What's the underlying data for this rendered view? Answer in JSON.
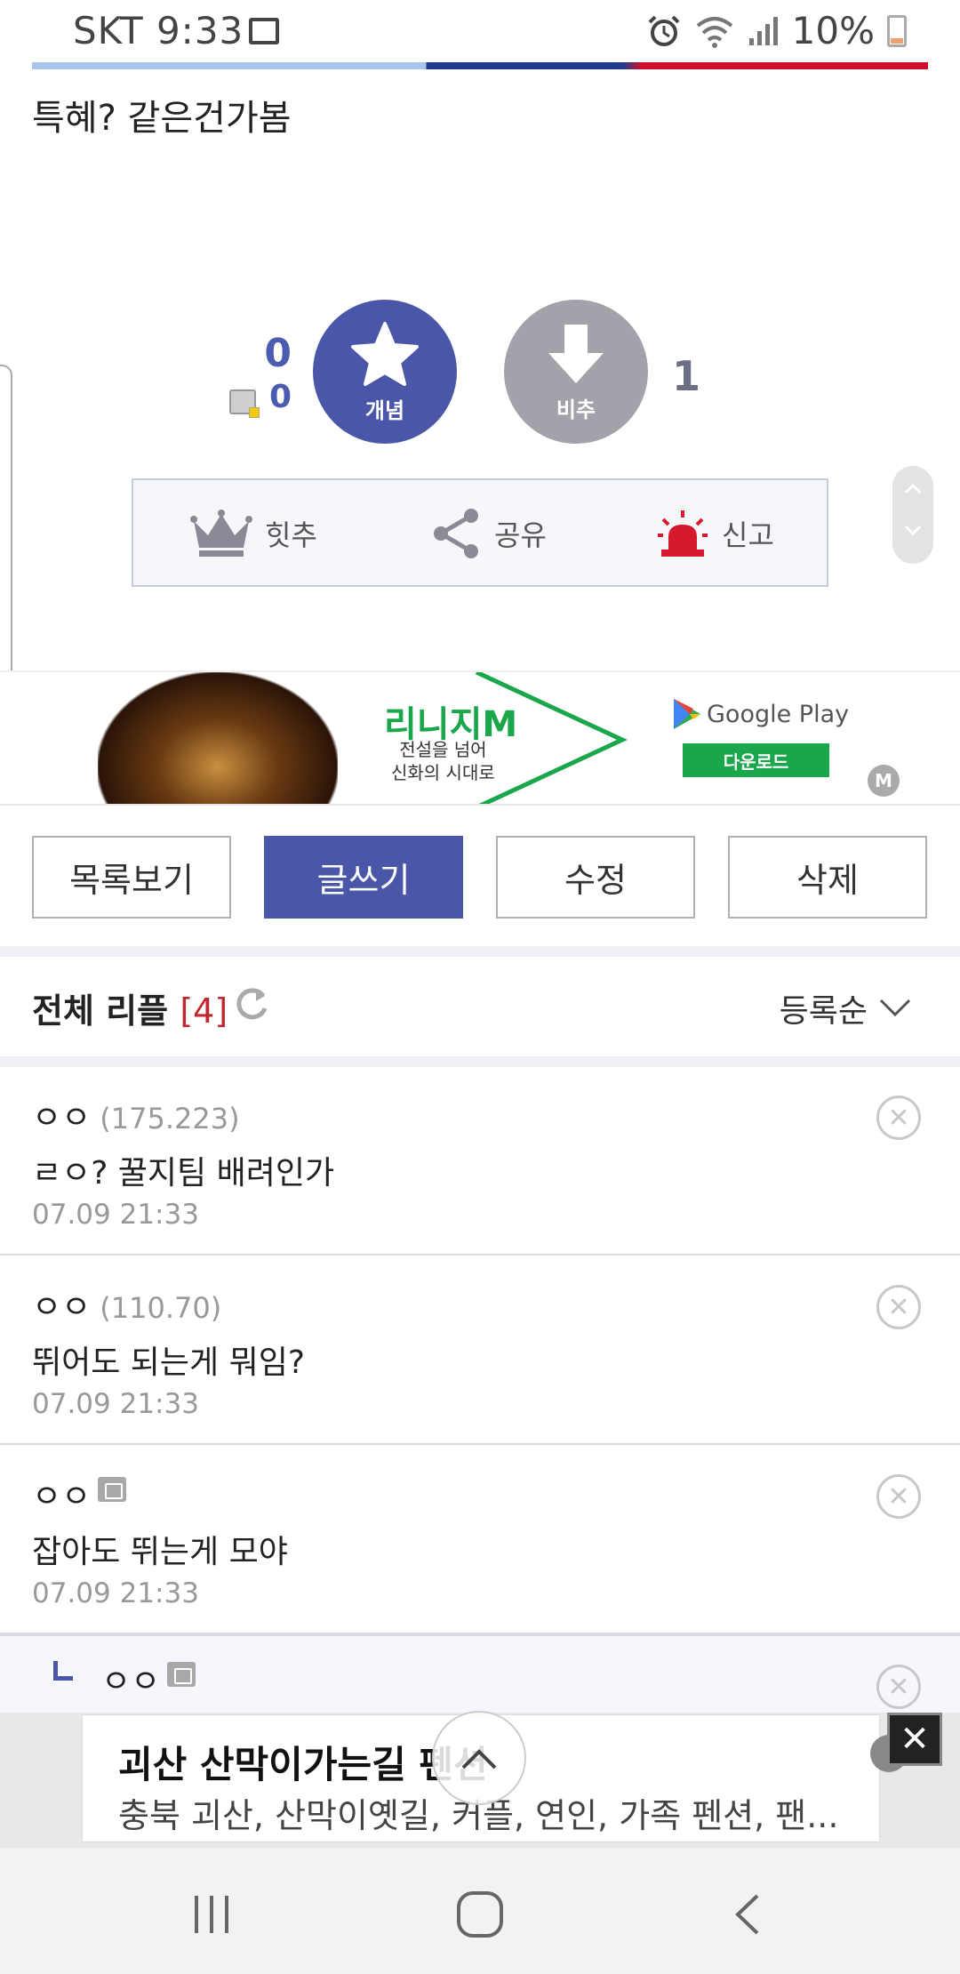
{
  "status_bar": {
    "carrier_time": "SKT 9:33",
    "battery": "10%",
    "icons": [
      "gallery-icon",
      "alarm-icon",
      "wifi-icon",
      "signal-icon",
      "battery-icon"
    ]
  },
  "post": {
    "body": "특혜? 같은건가봄"
  },
  "vote": {
    "up_count": "0",
    "fixed_up_count": "0",
    "up_label": "개념",
    "down_label": "비추",
    "down_count": "1"
  },
  "actions": {
    "hit": "힛추",
    "share": "공유",
    "report": "신고"
  },
  "ad_banner": {
    "title": "리니지M",
    "subtitle_line1": "전설을 넘어",
    "subtitle_line2": "신화의 시대로",
    "store": "Google Play",
    "download": "다운로드",
    "badge": "M"
  },
  "buttons": {
    "list": "목록보기",
    "write": "글쓰기",
    "edit": "수정",
    "delete": "삭제"
  },
  "comments_header": {
    "title": "전체 리플",
    "count": "[4]",
    "sort": "등록순"
  },
  "comments": [
    {
      "nick": "ㅇㅇ",
      "ip": "(175.223)",
      "body": "ㄹㅇ? 꿀지팀 배려인가",
      "date": "07.09 21:33"
    },
    {
      "nick": "ㅇㅇ",
      "ip": "(110.70)",
      "body": "뛰어도 되는게 뭐임?",
      "date": "07.09 21:33"
    },
    {
      "nick": "ㅇㅇ",
      "ip": "",
      "body": "잡아도 뛰는게 모야",
      "date": "07.09 21:33"
    }
  ],
  "reply": {
    "nick": "ㅇㅇ"
  },
  "bottom_ad": {
    "title": "괴산 산막이가는길 펜션",
    "description": "충북 괴산, 산막이옛길, 커플, 연인, 가족 펜션, 팬..."
  },
  "colors": {
    "accent": "#4a57a8",
    "count_red": "#c0282e",
    "ad_green": "#1aa64a"
  }
}
